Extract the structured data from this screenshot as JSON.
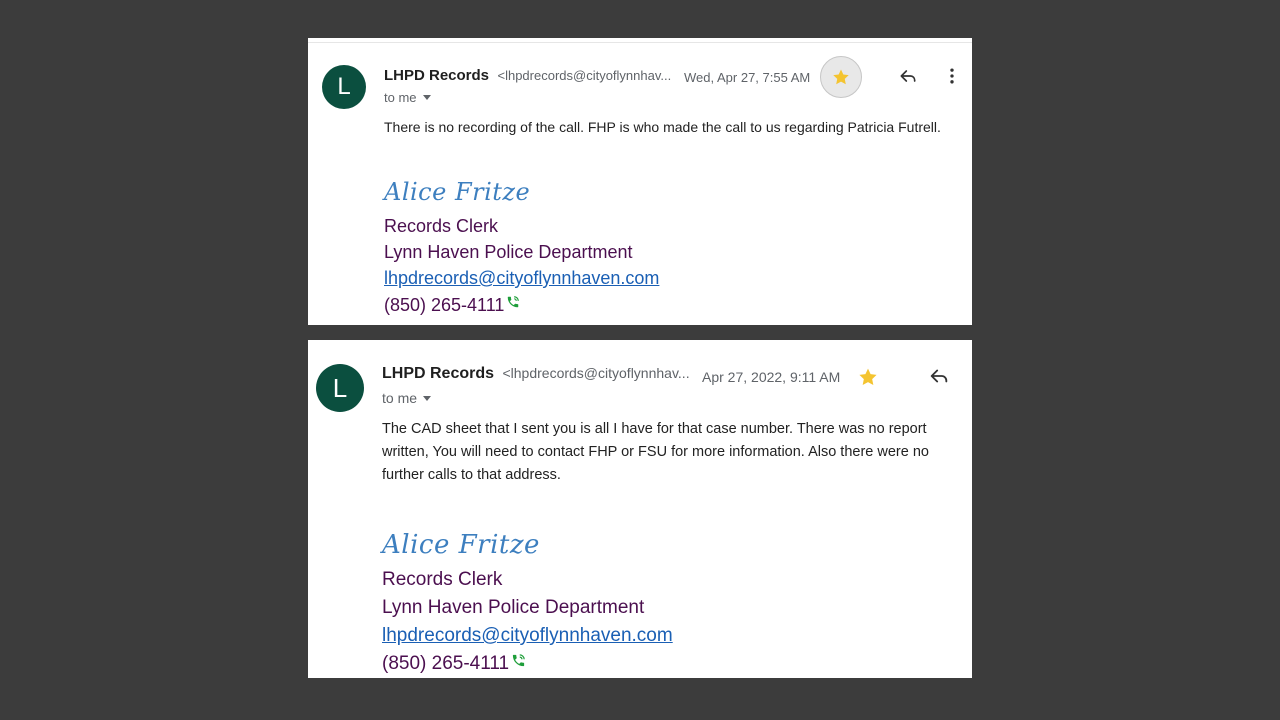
{
  "emails": [
    {
      "avatar_letter": "L",
      "sender_name": "LHPD Records",
      "sender_email": "<lhpdrecords@cityoflynnhav...",
      "date": "Wed, Apr 27, 7:55 AM",
      "recipient": "to me",
      "body": "There is no recording of the call.  FHP is who made the call to us regarding Patricia Futrell.",
      "signature": {
        "name": "Alice Fritze",
        "title": "Records Clerk",
        "department": "Lynn Haven Police Department",
        "email": "lhpdrecords@cityoflynnhaven.com",
        "phone": "(850) 265-4111"
      }
    },
    {
      "avatar_letter": "L",
      "sender_name": "LHPD Records",
      "sender_email": "<lhpdrecords@cityoflynnhav...",
      "date": "Apr 27, 2022, 9:11 AM",
      "recipient": "to me",
      "body_lines": [
        "The CAD sheet that I sent you is all I have for that case number.  There was no report",
        "written,  You will need to contact FHP or FSU for more information.  Also there were no",
        "further calls to that address."
      ],
      "signature": {
        "name": "Alice Fritze",
        "title": "Records Clerk",
        "department": "Lynn Haven Police Department",
        "email": "lhpdrecords@cityoflynnhaven.com",
        "phone": "(850) 265-4111"
      }
    }
  ],
  "colors": {
    "background": "#3c3c3c",
    "avatar": "#0b4f3f",
    "star": "#f4c430",
    "signature_name": "#3d7fbf",
    "signature_text": "#4b0f4f",
    "link": "#1a5fb4",
    "phone_icon": "#1e9e3a"
  },
  "icons": [
    "star-icon",
    "reply-icon",
    "more-vert-icon",
    "phone-icon",
    "caret-down-icon"
  ]
}
